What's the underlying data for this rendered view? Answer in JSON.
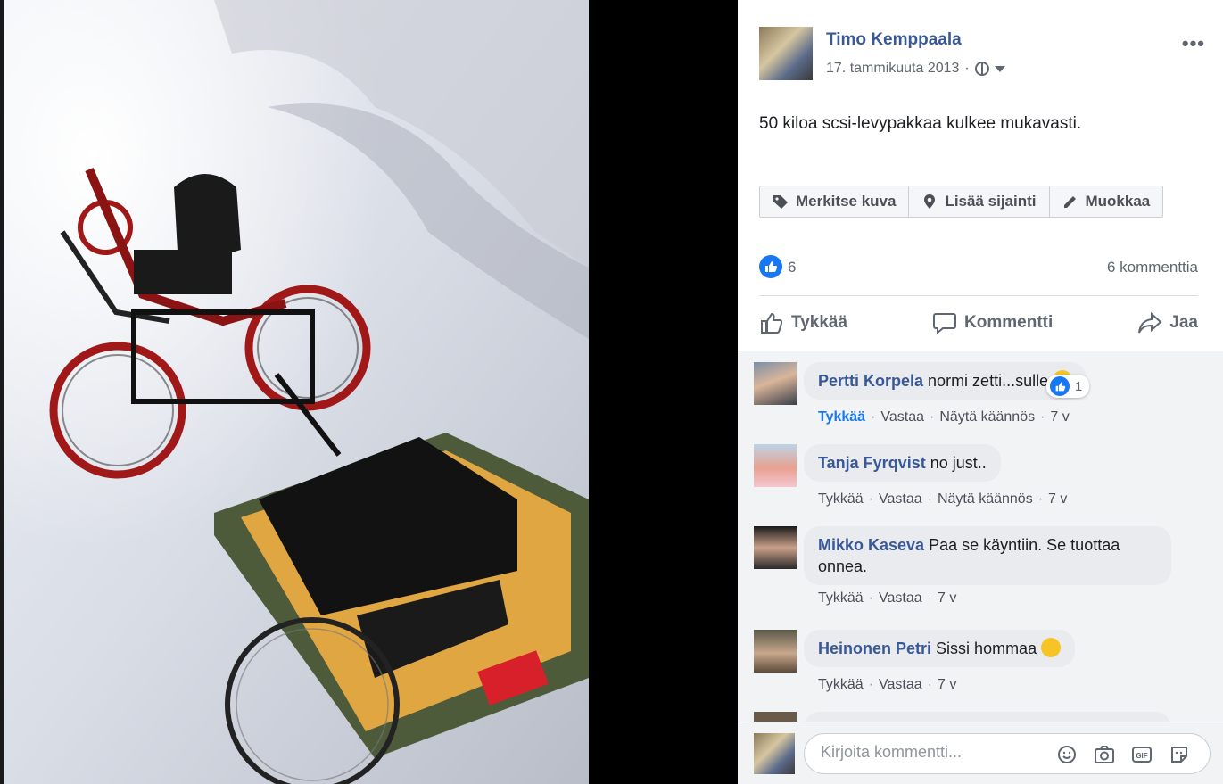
{
  "post": {
    "author": "Timo Kemppaala",
    "date": "17. tammikuuta 2013",
    "separator": "·",
    "more": "•••",
    "text": "50 kiloa scsi-levypakkaa kulkee mukavasti."
  },
  "photo_actions": {
    "tag": "Merkitse kuva",
    "location": "Lisää sijainti",
    "edit": "Muokkaa"
  },
  "stats": {
    "reactions": "6",
    "comments": "6 kommenttia"
  },
  "actions": {
    "like": "Tykkää",
    "comment": "Kommentti",
    "share": "Jaa"
  },
  "comments": [
    {
      "name": "Pertti Korpela",
      "text": "normi zetti...sulle",
      "like": "Tykkää",
      "reply": "Vastaa",
      "translate": "Näytä käännös",
      "time": "7 v",
      "reactions": "1"
    },
    {
      "name": "Tanja Fyrqvist",
      "text": "no just..",
      "like": "Tykkää",
      "reply": "Vastaa",
      "translate": "Näytä käännös",
      "time": "7 v"
    },
    {
      "name": "Mikko Kaseva",
      "text": "Paa se käyntiin. Se tuottaa",
      "text2": "onnea.",
      "like": "Tykkää",
      "reply": "Vastaa",
      "time": "7 v"
    },
    {
      "name": "Heinonen Petri",
      "text": "Sissi hommaa",
      "like": "Tykkää",
      "reply": "Vastaa",
      "time": "7 v"
    }
  ],
  "composer": {
    "placeholder": "Kirjoita kommentti..."
  },
  "colors": {
    "link": "#385898",
    "accent": "#1877f2",
    "bubble": "#e9ebee"
  }
}
